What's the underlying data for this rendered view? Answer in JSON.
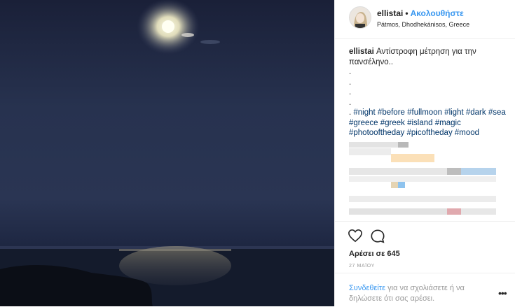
{
  "post": {
    "username": "ellistai",
    "separator": "•",
    "follow_label": "Ακολουθήστε",
    "location": "Pátmos, Dhodhekánisos, Greece",
    "caption_user": "ellistai",
    "caption_text": "Αντίστροφη μέτρηση για την πανσέληνο..",
    "caption_dots": [
      ".",
      ".",
      ".",
      "."
    ],
    "caption_tags_prefix": ". ",
    "caption_tags": "#night #before #fullmoon #light #dark #sea #greece #greek #island #magic #photooftheday #picoftheday #mood",
    "likes": "Αρέσει σε 645",
    "date": "27 ΜΑΪΟΥ",
    "login_link": "Συνδεθείτε",
    "login_rest": " για να σχολιάσετε ή να δηλώσετε ότι σας αρέσει.",
    "more_label": "•••"
  },
  "icons": {
    "heart": "heart-icon",
    "comment": "comment-icon",
    "more": "more-options-icon"
  },
  "colors": {
    "accent": "#3897f0",
    "hashtag": "#003569",
    "night_sky": "#1f2a45"
  }
}
